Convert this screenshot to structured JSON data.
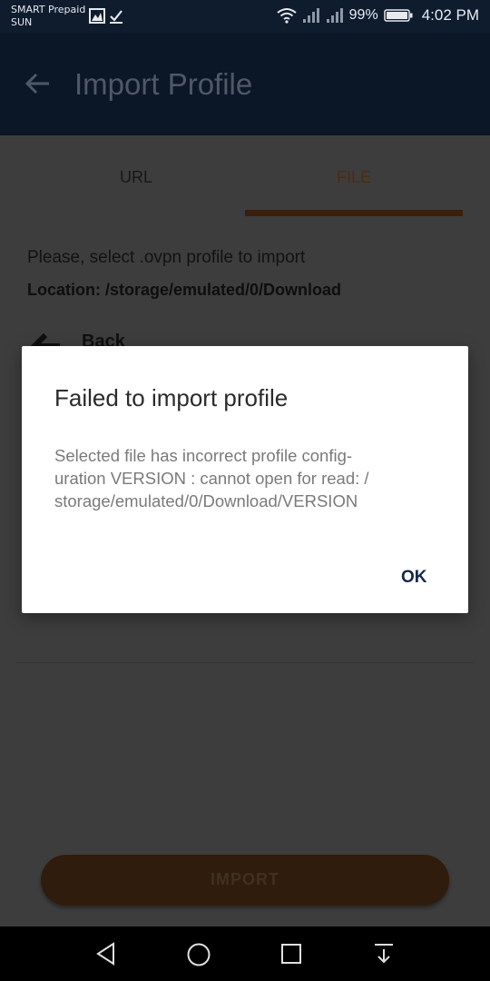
{
  "status_bar": {
    "carrier_line1": "SMART Prepaid",
    "carrier_line2": "SUN",
    "battery_percent": "99%",
    "time": "4:02 PM"
  },
  "app_bar": {
    "title": "Import Profile"
  },
  "tabs": [
    {
      "label": "URL",
      "selected": false
    },
    {
      "label": "FILE",
      "selected": true
    }
  ],
  "content": {
    "instruction": "Please, select .ovpn profile to import",
    "location": "Location: /storage/emulated/0/Download",
    "back_label": "Back",
    "import_button": "IMPORT"
  },
  "dialog": {
    "title": "Failed to import profile",
    "message_line1": "Selected file has incorrect profile config-",
    "message_line2": "uration VERSION : cannot open for read: /",
    "message_line3": "storage/emulated/0/Download/VERSION",
    "ok_label": "OK"
  },
  "colors": {
    "app_bar": "#0b1726",
    "accent": "#c7651c",
    "dialog_button": "#13294a"
  }
}
